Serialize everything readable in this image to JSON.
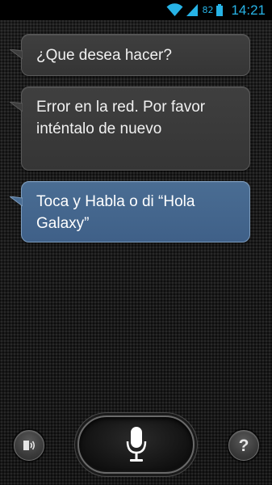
{
  "status_bar": {
    "battery_percent": "82",
    "time": "14:21",
    "accent_color": "#27b3e6"
  },
  "conversation": {
    "messages": [
      {
        "role": "assistant",
        "text": "¿Que desea hacer?"
      },
      {
        "role": "assistant",
        "text": "Error en la red. Por favor inténtalo de nuevo"
      },
      {
        "role": "prompt",
        "text": "Toca y Habla o di “Hola Galaxy”"
      }
    ]
  },
  "controls": {
    "speaker_icon": "speaker-icon",
    "mic_icon": "microphone-icon",
    "help_label": "?"
  }
}
